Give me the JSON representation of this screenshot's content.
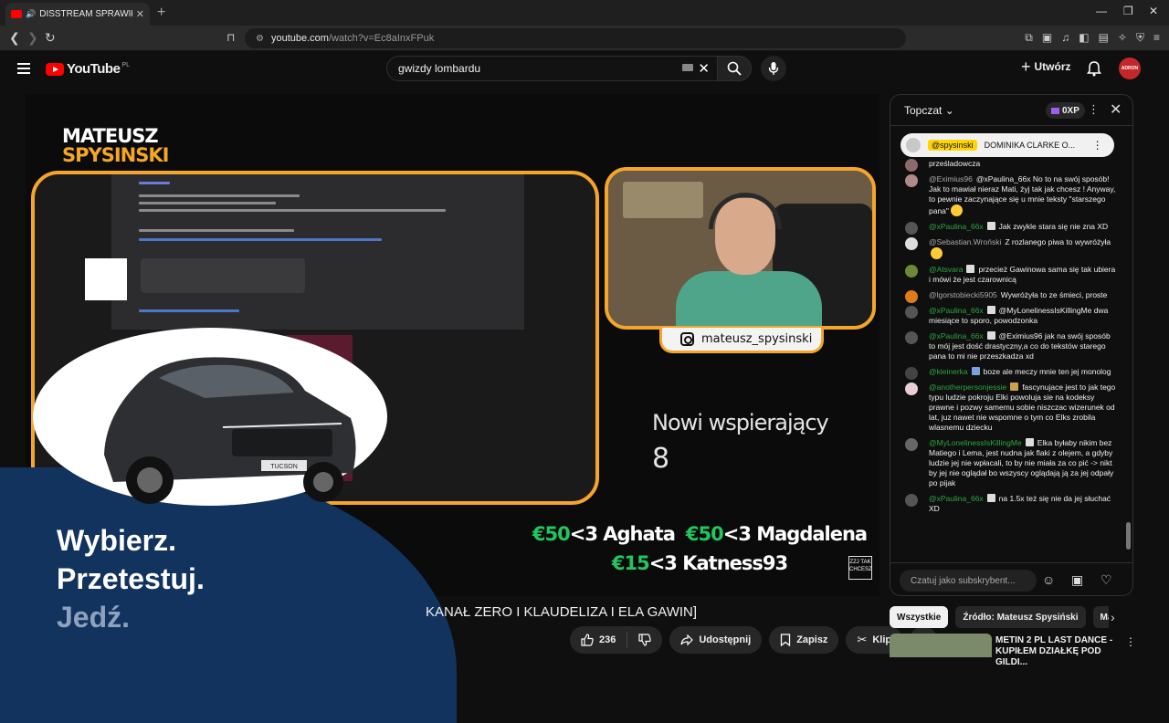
{
  "browser": {
    "tab_title": "DISSTREAM SPRAWIŁ, ŻE JD",
    "tab_close": "✕",
    "new_tab": "+",
    "url_host": "youtube.com",
    "url_path": "/watch?v=Ec8aInxFPuk"
  },
  "header": {
    "logo_text": "YouTube",
    "logo_country": "PL",
    "search_value": "gwizdy lombardu",
    "create_label": "Utwórz",
    "avatar_text": "ADRON"
  },
  "video": {
    "brand_line1": "MATEUSZ",
    "brand_line2": "SPYSINSKI",
    "instagram_handle": "mateusz_spysinski",
    "supporters_title": "Nowi wspierający",
    "supporters_count": "8",
    "donations": [
      {
        "amount": "€50",
        "name": "<3 Aghata"
      },
      {
        "amount": "€50",
        "name": "<3 Magdalena"
      },
      {
        "amount": "€15",
        "name": "<3 Katness93"
      }
    ],
    "watermark": "ZZJ TAK CHCESZ",
    "title_fragment": "KANAŁ ZERO I KLAUDELIZA I ELA GAWIN]"
  },
  "ad": {
    "line1": "Wybierz.",
    "line2": "Przetestuj.",
    "line3": "Jedź.",
    "car_plate": "TUCSON"
  },
  "actions": {
    "likes": "236",
    "share": "Udostępnij",
    "save": "Zapisz",
    "clip": "Klip"
  },
  "chat": {
    "title": "Topczat",
    "xp": "0XP",
    "pinned_author": "@spysinski",
    "pinned_text": "DOMINIKA CLARKE O...",
    "input_placeholder": "Czatuj jako subskrybent...",
    "messages": [
      {
        "author": "",
        "text": "prześladowcza",
        "member": false
      },
      {
        "author": "@Eximius96",
        "text": "@xPaulina_66x No to na swój sposób! Jak to mawiał nieraz Mati, żyj tak jak chcesz ! Anyway, to pewnie zaczynające się u mnie teksty \"starszego pana\"",
        "member": false
      },
      {
        "author": "@xPaulina_66x",
        "text": "Jak zwykle stara się nie zna XD",
        "member": true
      },
      {
        "author": "@Sebastian.Wroński",
        "text": "Z rozlanego piwa to wywróżyła",
        "member": false
      },
      {
        "author": "@Atsvara",
        "text": "przecież Gawinowa sama się tak ubiera i mówi że jest czarownicą",
        "member": true
      },
      {
        "author": "@lgorstobiecki5905",
        "text": "Wywróżyła to ze śmieci, proste",
        "member": false
      },
      {
        "author": "@xPaulina_66x",
        "text": "@MyLonelinessIsKillingMe dwa miesiące to sporo, powodzonka",
        "member": true
      },
      {
        "author": "@xPaulina_66x",
        "text": "@Eximius96 jak na swój sposób to mój jest dość drastyczny,a co do tekstów starego pana to mi nie przeszkadza xd",
        "member": true
      },
      {
        "author": "@kleinerka",
        "text": "boze ale meczy mnie ten jej monolog",
        "member": true
      },
      {
        "author": "@anotherpersonjessie",
        "text": "fascynujace jest to jak tego typu ludzie pokroju Elki powoluja sie na kodeksy prawne i pozwy samemu sobie niszczac wizerunek od lat, juz nawet nie wspomne o tym co Elks zrobila wlasnemu dziecku",
        "member": true
      },
      {
        "author": "@MyLonelinessIsKillingMe",
        "text": "Elka byłaby nikim bez Matiego i Lema, jest nudna jak flaki z olejem, a gdyby ludzie jej nie wpłacali, to by nie miała za co pić -> nikt by jej nie oglądał bo wszyscy oglądają ją za jej odpały po pijak",
        "member": true
      },
      {
        "author": "@xPaulina_66x",
        "text": "na 1.5x też się nie da jej słuchać XD",
        "member": true
      }
    ]
  },
  "chips": [
    "Wszystkie",
    "Źródło: Mateusz Spysiński",
    "Mateusz"
  ],
  "recommended": {
    "title": "METIN 2 PL LAST DANCE - KUPIŁEM DZIAŁKĘ POD GILDI..."
  },
  "colors": {
    "accent_orange": "#f5a52a",
    "donation_green": "#22c55e",
    "member_green": "#2ba640",
    "yt_red": "#ff0000",
    "ad_blue": "#12335e"
  }
}
